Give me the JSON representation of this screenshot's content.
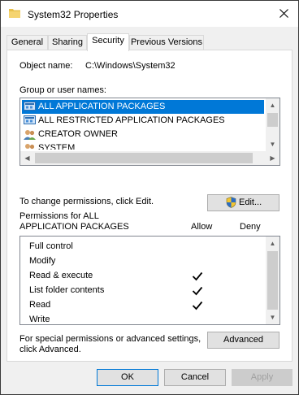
{
  "window": {
    "title": "System32 Properties",
    "icon": "folder-icon"
  },
  "tabs": [
    {
      "label": "General",
      "active": false
    },
    {
      "label": "Sharing",
      "active": false
    },
    {
      "label": "Security",
      "active": true
    },
    {
      "label": "Previous Versions",
      "active": false
    }
  ],
  "object": {
    "label": "Object name:",
    "value": "C:\\Windows\\System32"
  },
  "groups": {
    "label": "Group or user names:",
    "items": [
      {
        "label": "ALL APPLICATION PACKAGES",
        "icon": "app-package-icon",
        "selected": true
      },
      {
        "label": "ALL RESTRICTED APPLICATION PACKAGES",
        "icon": "app-package-icon",
        "selected": false
      },
      {
        "label": "CREATOR OWNER",
        "icon": "users-icon",
        "selected": false
      },
      {
        "label": "SYSTEM",
        "icon": "users-icon",
        "selected": false
      }
    ]
  },
  "change": {
    "text": "To change permissions, click Edit.",
    "edit_label": "Edit..."
  },
  "permissions": {
    "header_line1": "Permissions for ALL",
    "header_line2": "APPLICATION PACKAGES",
    "allow_label": "Allow",
    "deny_label": "Deny",
    "rows": [
      {
        "label": "Full control",
        "allow": false,
        "deny": false
      },
      {
        "label": "Modify",
        "allow": false,
        "deny": false
      },
      {
        "label": "Read & execute",
        "allow": true,
        "deny": false
      },
      {
        "label": "List folder contents",
        "allow": true,
        "deny": false
      },
      {
        "label": "Read",
        "allow": true,
        "deny": false
      },
      {
        "label": "Write",
        "allow": false,
        "deny": false
      }
    ]
  },
  "advanced": {
    "text_line1": "For special permissions or advanced settings,",
    "text_line2": "click Advanced.",
    "button_label": "Advanced"
  },
  "footer": {
    "ok_label": "OK",
    "cancel_label": "Cancel",
    "apply_label": "Apply"
  },
  "colors": {
    "selection": "#0078d7",
    "panel": "#ffffff",
    "background": "#f0f0f0"
  }
}
